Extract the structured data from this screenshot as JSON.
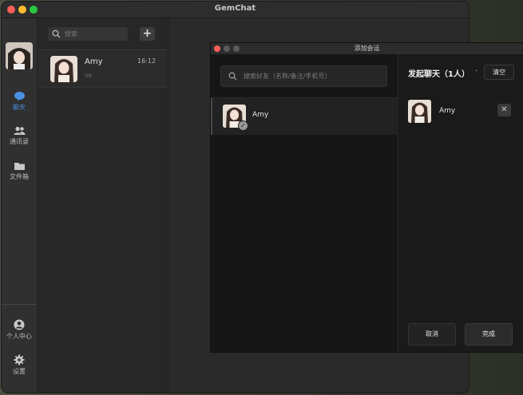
{
  "window": {
    "title": "GemChat"
  },
  "sidebar": {
    "items": [
      {
        "label": "聊天",
        "icon": "chat-bubble-icon",
        "active": true
      },
      {
        "label": "通讯录",
        "icon": "contacts-icon",
        "active": false
      },
      {
        "label": "文件箱",
        "icon": "folder-icon",
        "active": false
      },
      {
        "label": "个人中心",
        "icon": "user-circle-icon",
        "active": false
      },
      {
        "label": "设置",
        "icon": "gear-icon",
        "active": false
      }
    ]
  },
  "chat_list": {
    "search_placeholder": "搜索",
    "conversations": [
      {
        "name": "Amy",
        "time": "16:12",
        "last_message": "ok"
      }
    ]
  },
  "dialog": {
    "title": "添加会话",
    "search_placeholder": "搜索好友（名称/备注/手机号）",
    "friends": [
      {
        "name": "Amy",
        "selected": true
      }
    ],
    "start_chat_title": "发起聊天（1人）",
    "dot": "·",
    "clear_label": "清空",
    "selected": [
      {
        "name": "Amy"
      }
    ],
    "cancel_label": "取消",
    "done_label": "完成"
  },
  "colors": {
    "accent": "#4a90e2",
    "dialog_bg": "#1a1a1a",
    "sidebar_bg": "#303030"
  }
}
